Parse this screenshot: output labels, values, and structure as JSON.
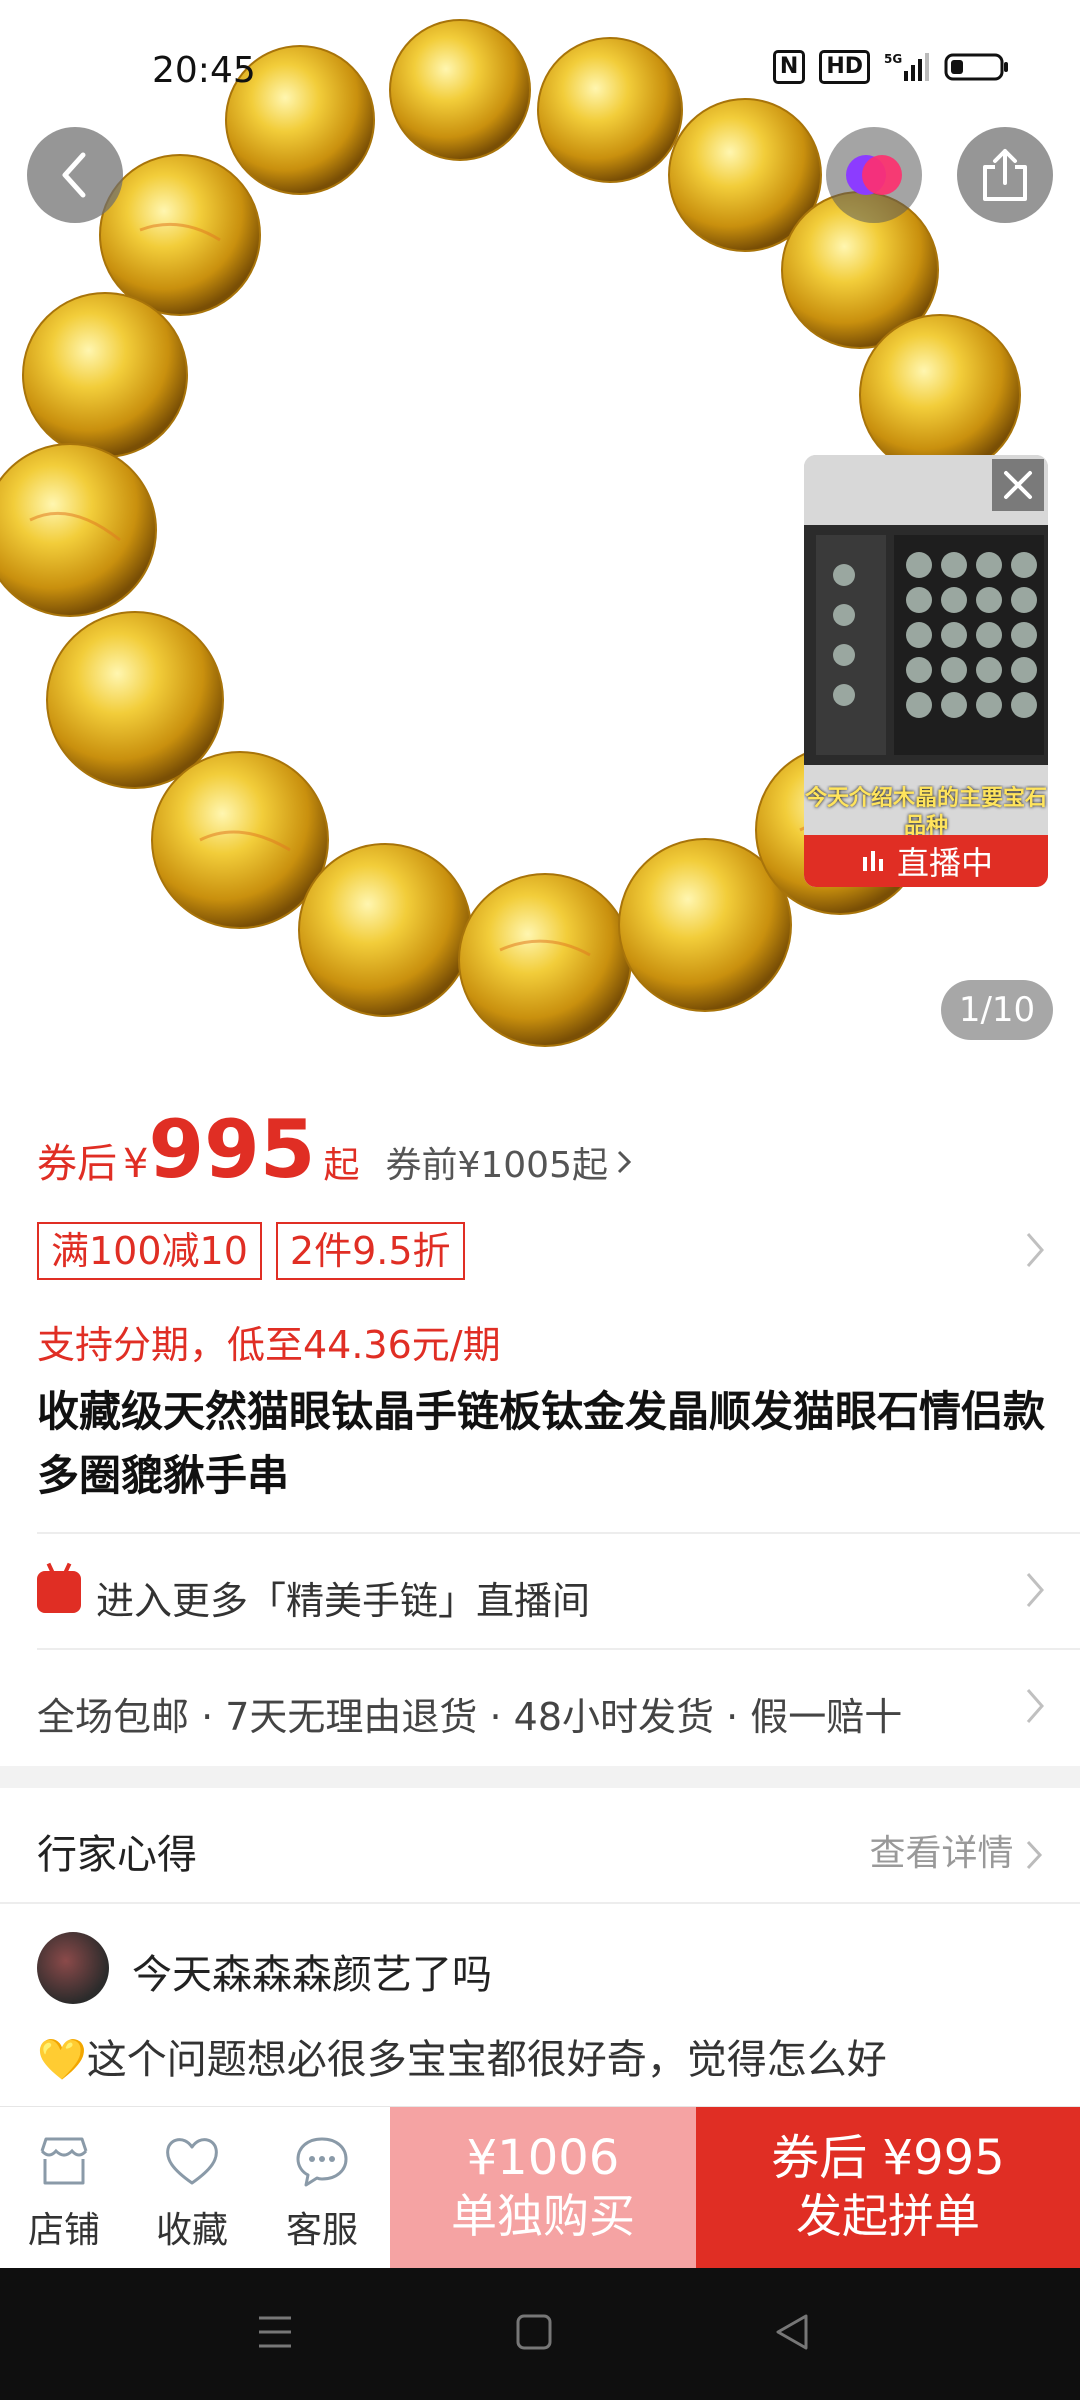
{
  "status_bar": {
    "time": "20:45",
    "nfc": "N",
    "hd": "HD",
    "network": "5G"
  },
  "hero": {
    "pager": "1/10",
    "live_badge": "直播中",
    "live_caption": "今天介绍木晶的主要宝石品种"
  },
  "price": {
    "coupon_label": "券后",
    "currency": "¥",
    "amount": "995",
    "qi": "起",
    "before_coupon": "券前¥1005起",
    "tags": [
      "满100减10",
      "2件9.5折"
    ],
    "installment": "支持分期，低至44.36元/期"
  },
  "product": {
    "title": "收藏级天然猫眼钛晶手链板钛金发晶顺发猫眼石情侣款多圈貔貅手串"
  },
  "rows": {
    "live_entry": "进入更多「精美手链」直播间",
    "services": "全场包邮 · 7天无理由退货 · 48小时发货 · 假一赔十"
  },
  "expert": {
    "title": "行家心得",
    "more": "查看详情",
    "author": "今天森森森颜艺了吗",
    "excerpt": "💛这个问题想必很多宝宝都很好奇，觉得怎么好"
  },
  "bottom": {
    "shop": "店铺",
    "favorite": "收藏",
    "service": "客服",
    "solo_price": "¥1006",
    "solo_label": "单独购买",
    "group_price": "券后 ¥995",
    "group_label": "发起拼单"
  },
  "colors": {
    "accent": "#e02e24",
    "solo_button": "#f5a3a3",
    "bead_gold": "#e2b019"
  }
}
